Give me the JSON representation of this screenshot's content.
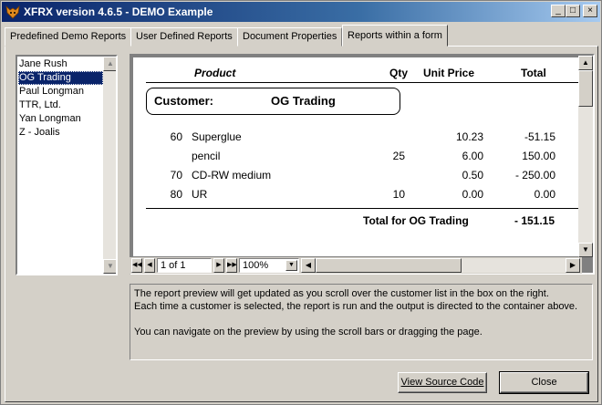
{
  "window": {
    "title": "XFRX version 4.6.5 - DEMO Example",
    "controls": [
      "_",
      "□",
      "×"
    ]
  },
  "tabs": [
    {
      "label": "Predefined Demo Reports",
      "active": false
    },
    {
      "label": "User Defined Reports",
      "active": false
    },
    {
      "label": "Document Properties",
      "active": false
    },
    {
      "label": "Reports within a form",
      "active": true
    }
  ],
  "customers": {
    "items": [
      "Jane Rush",
      "OG Trading",
      "Paul Longman",
      "TTR, Ltd.",
      "Yan Longman",
      "Z - Joalis"
    ],
    "selected": "OG Trading"
  },
  "report": {
    "headers": {
      "product": "Product",
      "qty": "Qty",
      "unit_price": "Unit Price",
      "total": "Total"
    },
    "customer_label": "Customer:",
    "customer_name": "OG Trading",
    "rows": [
      {
        "code": "60",
        "product": "Superglue",
        "qty": "",
        "unit_price": "10.23",
        "total": "-51.15"
      },
      {
        "code": "",
        "product": "pencil",
        "qty": "25",
        "unit_price": "6.00",
        "total": "150.00"
      },
      {
        "code": "70",
        "product": "CD-RW medium",
        "qty": "",
        "unit_price": "0.50",
        "total": "- 250.00"
      },
      {
        "code": "80",
        "product": "UR",
        "qty": "10",
        "unit_price": "0.00",
        "total": "0.00"
      }
    ],
    "total_label": "Total for OG Trading",
    "total_value": "- 151.15"
  },
  "preview_toolbar": {
    "page_indicator": "1 of 1",
    "zoom": "100%"
  },
  "description": {
    "lines": [
      "The report preview will get updated as you scroll over the customer list in the box on the right.",
      "Each time a customer is selected, the report is run and the output is directed to the container above.",
      "",
      "You can navigate on the preview by using the scroll bars or dragging the page."
    ]
  },
  "buttons": {
    "view_source": "View Source Code",
    "close": "Close"
  },
  "colors": {
    "title_bar": "#0a246a",
    "face": "#d4d0c8",
    "selection": "#0a246a"
  }
}
